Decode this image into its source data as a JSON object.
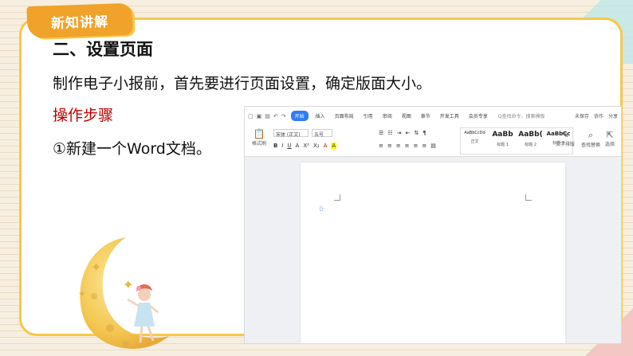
{
  "tag": "新知讲解",
  "section_title": "二、设置页面",
  "intro_line": "制作电子小报前，首先要进行页面设置，确定版面大小。",
  "steps_title": "操作步骤",
  "step1": "①新建一个Word文档。",
  "colors": {
    "accent_yellow": "#f6c84a",
    "tag_orange": "#f0a22a",
    "steps_red": "#c00000",
    "word_blue": "#2f7cf6"
  },
  "word": {
    "quick_icons": [
      "file-icon",
      "save-icon",
      "print-icon",
      "undo-icon",
      "redo-icon"
    ],
    "tabs": [
      "开始",
      "插入",
      "页面布局",
      "引用",
      "审阅",
      "视图",
      "章节",
      "开发工具",
      "会员专享"
    ],
    "active_tab": "开始",
    "search": "Q查找命令、搜索模板",
    "right": [
      "未保存",
      "协作",
      "分享"
    ],
    "paste_label": "格式刷",
    "font_name": "宋体 (正文)",
    "font_size": "五号",
    "format_row": [
      "B",
      "I",
      "U",
      "A",
      "X²",
      "X₂",
      "A",
      "A"
    ],
    "para_row": [
      "≡",
      "≡",
      "≡",
      "≡",
      "≡",
      "≡",
      "▤"
    ],
    "styles": [
      {
        "preview": "AaBbCcDd",
        "name": "正文"
      },
      {
        "preview": "AaBb",
        "name": "标题 1"
      },
      {
        "preview": "AaBb(",
        "name": "标题 2"
      },
      {
        "preview": "AaBbCc",
        "name": "标题 3"
      }
    ],
    "tools": [
      "文字排版",
      "查找替换",
      "选择"
    ]
  }
}
